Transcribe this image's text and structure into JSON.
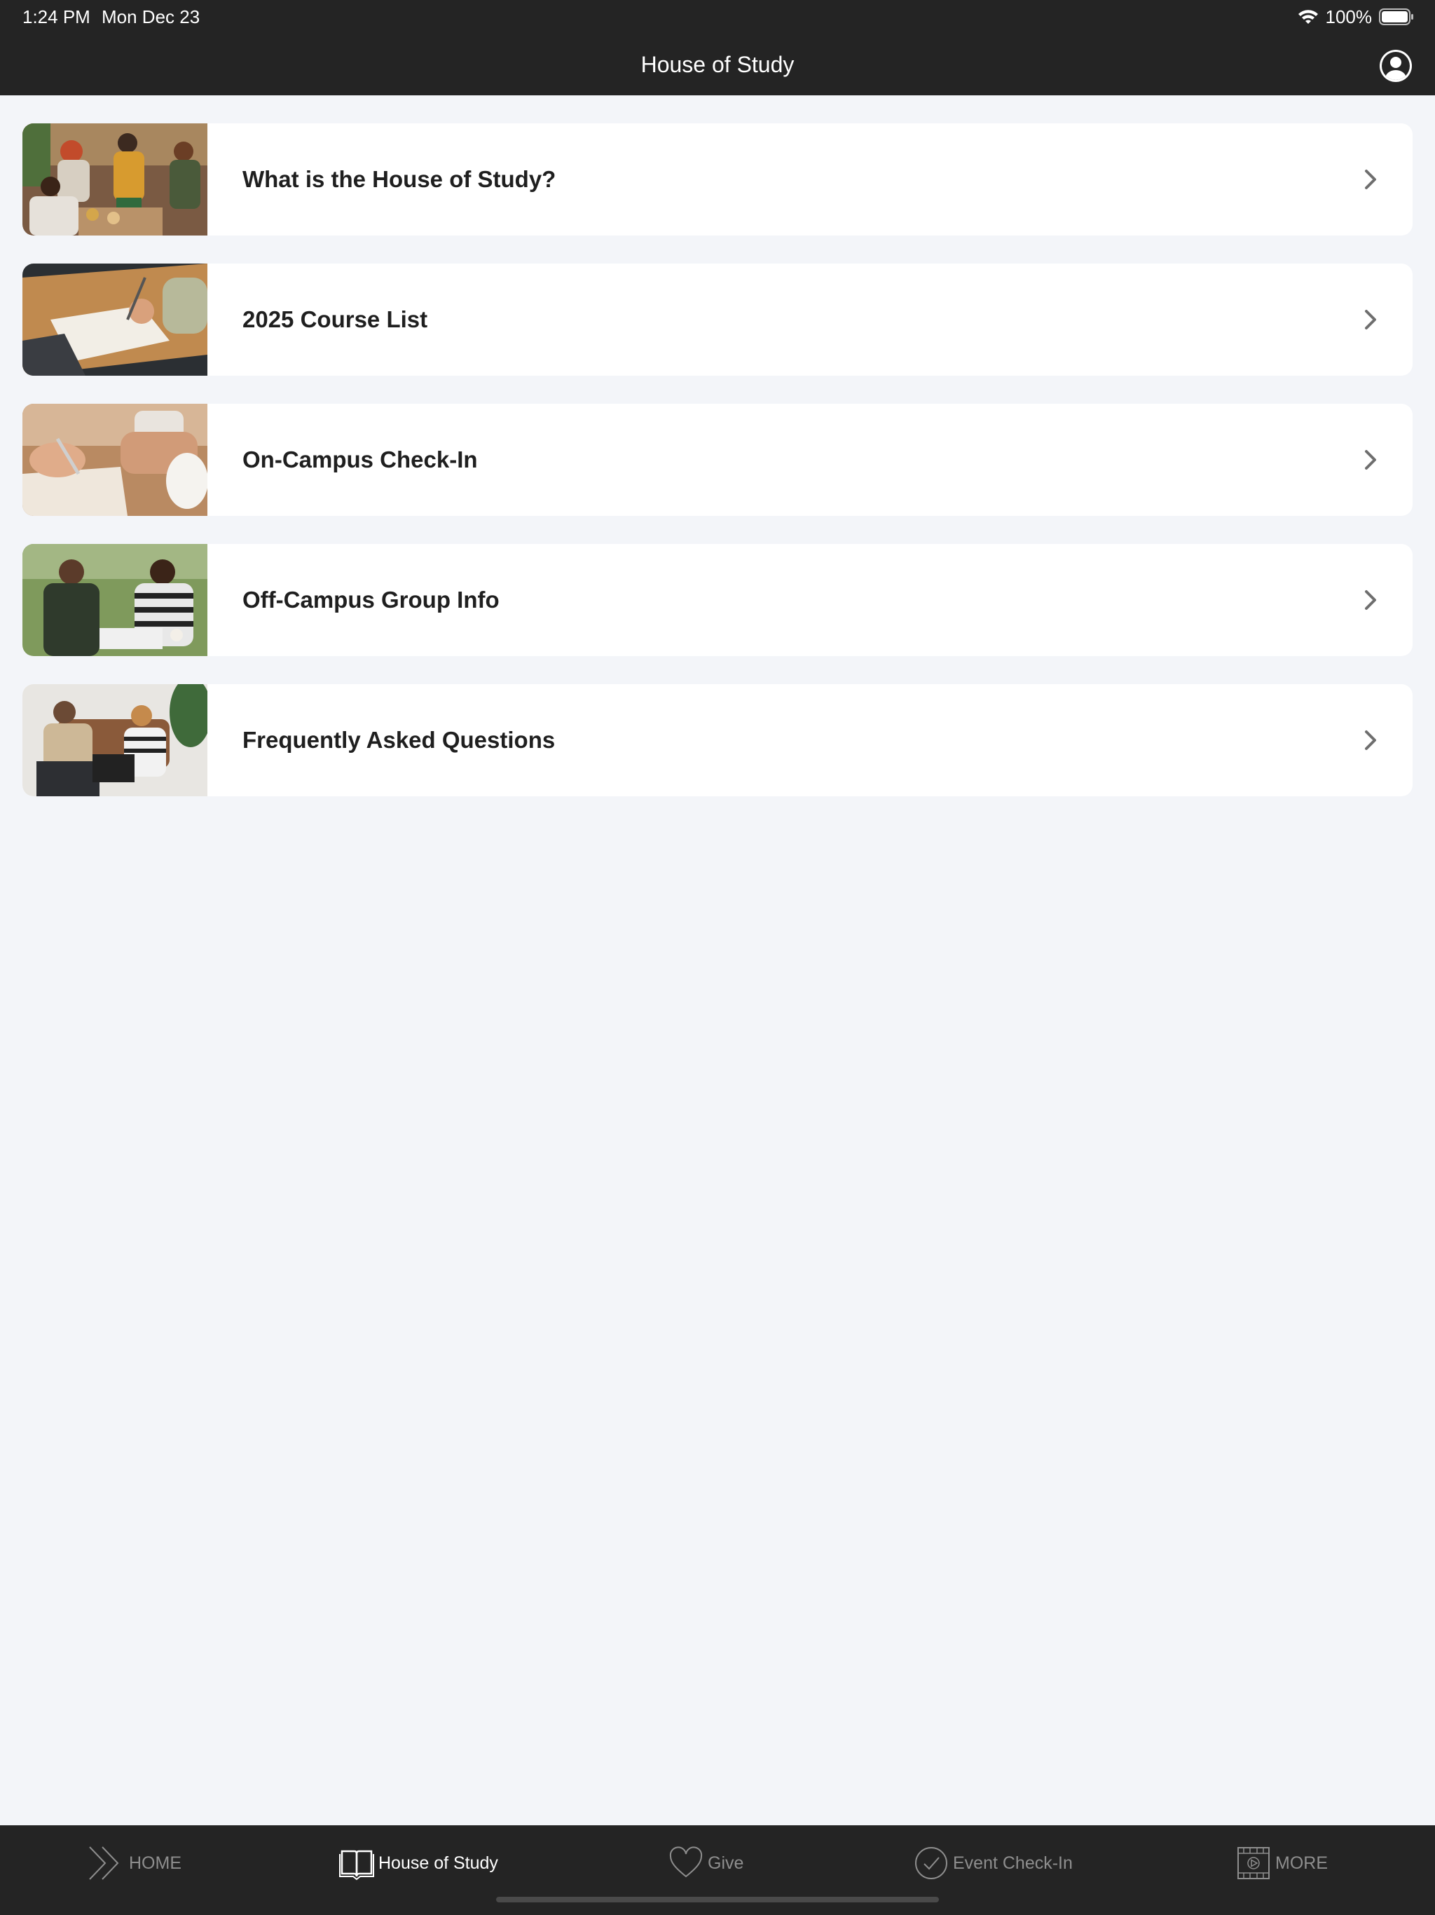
{
  "status": {
    "time": "1:24 PM",
    "date": "Mon Dec 23",
    "battery": "100%"
  },
  "header": {
    "title": "House of Study"
  },
  "items": [
    {
      "label": "What is the House of Study?"
    },
    {
      "label": "2025 Course List"
    },
    {
      "label": "On-Campus Check-In"
    },
    {
      "label": "Off-Campus Group Info"
    },
    {
      "label": "Frequently Asked Questions"
    }
  ],
  "tabs": [
    {
      "label": "HOME",
      "icon": "double-chevron-icon",
      "active": false
    },
    {
      "label": "House of Study",
      "icon": "book-icon",
      "active": true
    },
    {
      "label": "Give",
      "icon": "heart-icon",
      "active": false
    },
    {
      "label": "Event Check-In",
      "icon": "check-circle-icon",
      "active": false
    },
    {
      "label": "MORE",
      "icon": "film-play-icon",
      "active": false
    }
  ],
  "colors": {
    "bar_background": "#242424",
    "page_background": "#f3f5f9",
    "card_background": "#ffffff",
    "inactive_tab": "#8e8e8e",
    "active_tab": "#ffffff"
  }
}
